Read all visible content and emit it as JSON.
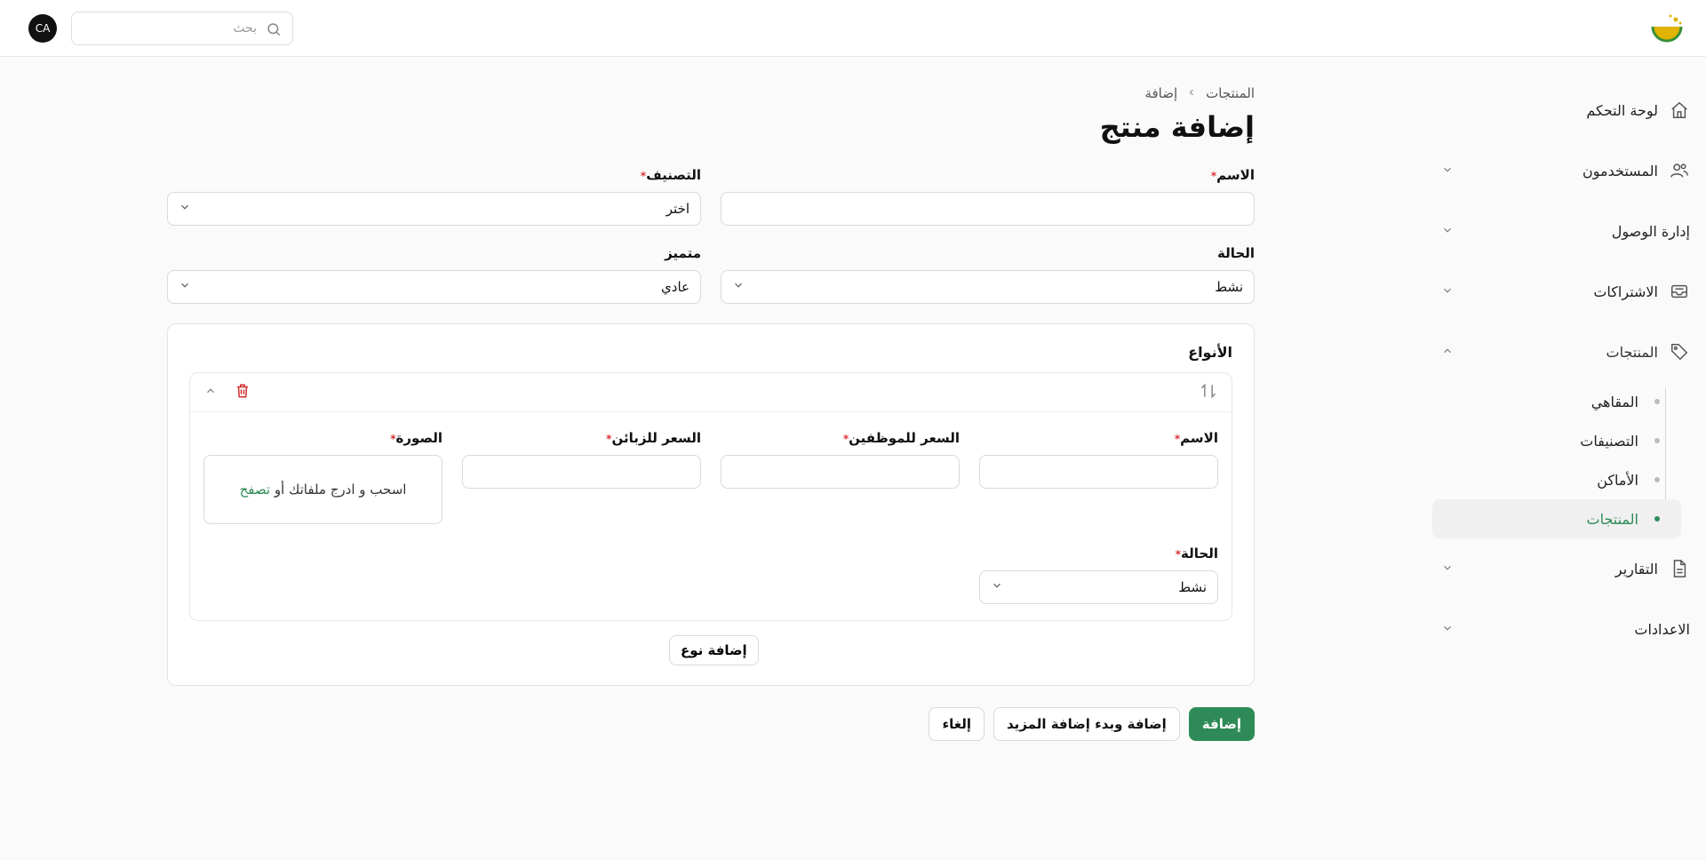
{
  "header": {
    "avatar_initials": "CA",
    "search_placeholder": "بحث"
  },
  "sidebar": {
    "items": [
      {
        "label": "لوحة التحكم",
        "icon": "home-icon",
        "has_chevron": false
      },
      {
        "label": "المستخدمون",
        "icon": "users-icon",
        "has_chevron": true
      },
      {
        "label": "إدارة الوصول",
        "icon": "",
        "has_chevron": true
      },
      {
        "label": "الاشتراكات",
        "icon": "inbox-icon",
        "has_chevron": true
      },
      {
        "label": "المنتجات",
        "icon": "tag-icon",
        "has_chevron": true,
        "expanded": true
      },
      {
        "label": "التقارير",
        "icon": "file-icon",
        "has_chevron": true
      },
      {
        "label": "الاعدادات",
        "icon": "",
        "has_chevron": true
      }
    ],
    "sub_items": [
      {
        "label": "المقاهي"
      },
      {
        "label": "التصنيفات"
      },
      {
        "label": "الأماكن"
      },
      {
        "label": "المنتجات",
        "active": true
      }
    ]
  },
  "breadcrumb": {
    "parent": "المنتجات",
    "current": "إضافة"
  },
  "page_title": "إضافة منتج",
  "form": {
    "name_label": "الاسم",
    "category_label": "التصنيف",
    "category_value": "اختر",
    "status_label": "الحالة",
    "status_value": "نشط",
    "featured_label": "متميز",
    "featured_value": "عادي"
  },
  "variants": {
    "title": "الأنواع",
    "name_label": "الاسم",
    "employee_price_label": "السعر للموظفين",
    "customer_price_label": "السعر للزبائن",
    "image_label": "الصورة",
    "dropzone_text": "اسحب و ادرج ملفاتك أو",
    "dropzone_link": "تصفح",
    "status_label": "الحالة",
    "status_value": "نشط",
    "add_variant_label": "إضافة نوع"
  },
  "actions": {
    "submit_label": "إضافة",
    "submit_more_label": "إضافة وبدء إضافة المزيد",
    "cancel_label": "إلغاء"
  },
  "colors": {
    "accent": "#2e8b57",
    "danger": "#d32f2f"
  }
}
